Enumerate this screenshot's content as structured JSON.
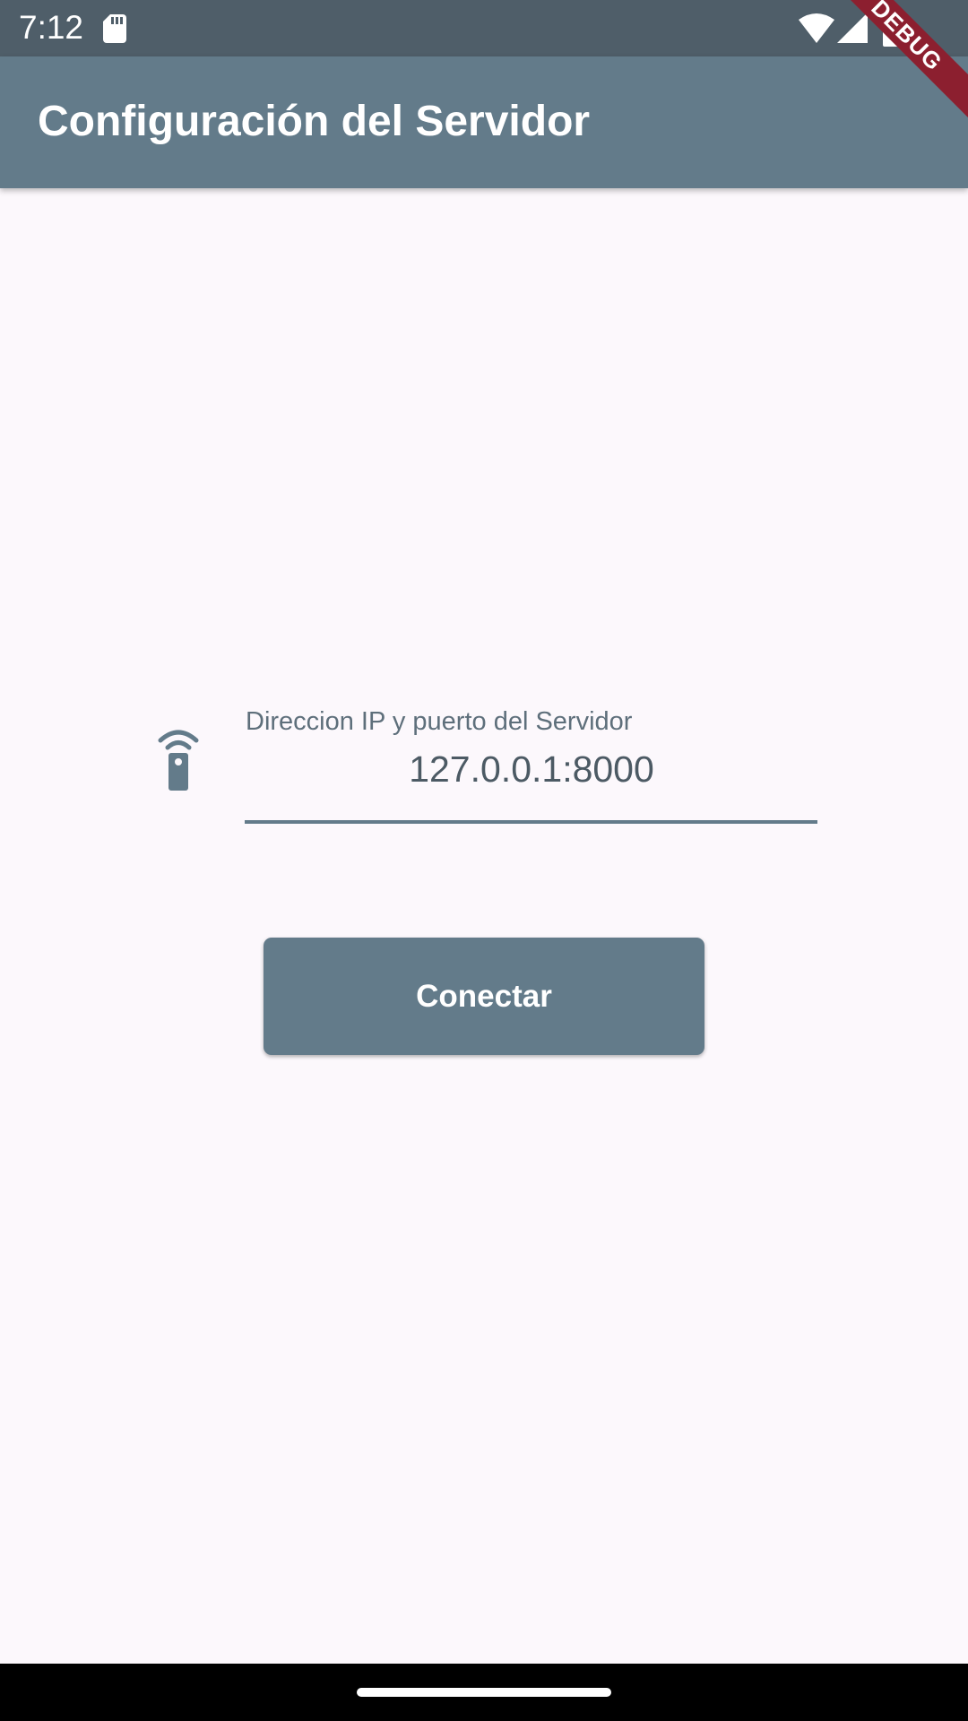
{
  "status_bar": {
    "time": "7:12",
    "icons": [
      "sd-card-icon",
      "wifi-icon",
      "signal-icon",
      "battery-icon"
    ]
  },
  "debug_banner": "DEBUG",
  "app_bar": {
    "title": "Configuración del Servidor"
  },
  "server_form": {
    "field_icon": "settings-remote-icon",
    "label": "Direccion IP y puerto del Servidor",
    "value": "127.0.0.1:8000",
    "connect_label": "Conectar"
  },
  "colors": {
    "primary": "#637b8a",
    "status_bar": "#4f5e69",
    "background": "#fcf8fc",
    "debug_banner": "#8c1f2f"
  }
}
